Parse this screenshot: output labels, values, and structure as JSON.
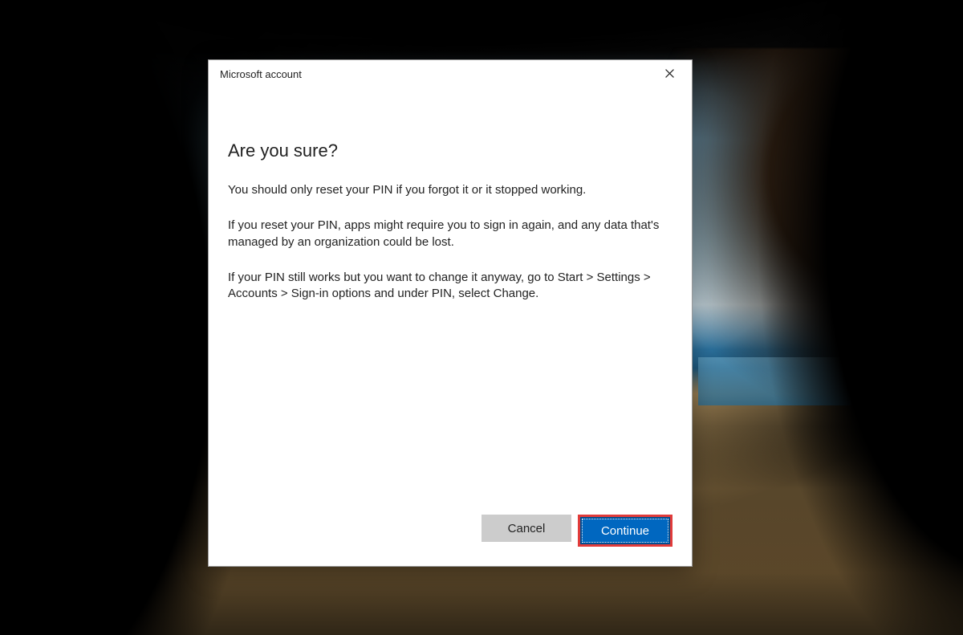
{
  "dialog": {
    "title": "Microsoft account",
    "heading": "Are you sure?",
    "paragraph1": "You should only reset your PIN if you forgot it or it stopped working.",
    "paragraph2": "If you reset your PIN, apps might require you to sign in again, and any data that's managed by an organization could be lost.",
    "paragraph3": "If your PIN still works but you want to change it anyway, go to Start > Settings > Accounts > Sign-in options and under PIN, select Change.",
    "buttons": {
      "cancel": "Cancel",
      "continue": "Continue"
    }
  }
}
